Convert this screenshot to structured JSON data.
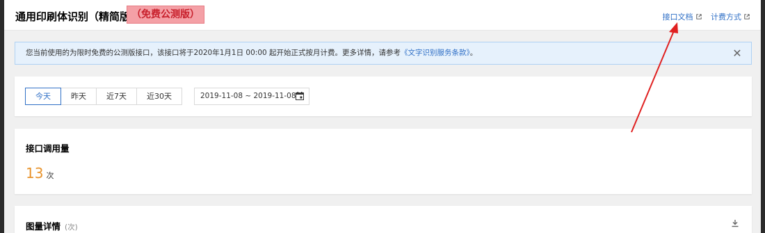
{
  "header": {
    "title": "通用印刷体识别（精简版）",
    "badge": "（免费公测版）",
    "links": [
      {
        "label": "接口文档",
        "icon": "external-link-icon"
      },
      {
        "label": "计费方式",
        "icon": "external-link-icon"
      }
    ]
  },
  "notice": {
    "text": "您当前使用的为限时免费的公测版接口，该接口将于2020年1月1日 00:00 起开始正式按月计费。更多详情，请参考",
    "link": "《文字识别服务条款》",
    "suffix": "。",
    "close_label": "✕"
  },
  "filter": {
    "tabs": [
      "今天",
      "昨天",
      "近7天",
      "近30天"
    ],
    "active_tab": "今天",
    "date_range": "2019-11-08 ~ 2019-11-08"
  },
  "usage": {
    "title": "接口调用量",
    "value": "13",
    "unit": "次"
  },
  "detail": {
    "title": "图量详情",
    "unit": "(次)"
  },
  "colors": {
    "link": "#2f6fc6",
    "accent_number": "#e8932c",
    "badge_bg": "#f4a0a6",
    "badge_text": "#c8202c",
    "annotation_arrow": "#e02020"
  }
}
